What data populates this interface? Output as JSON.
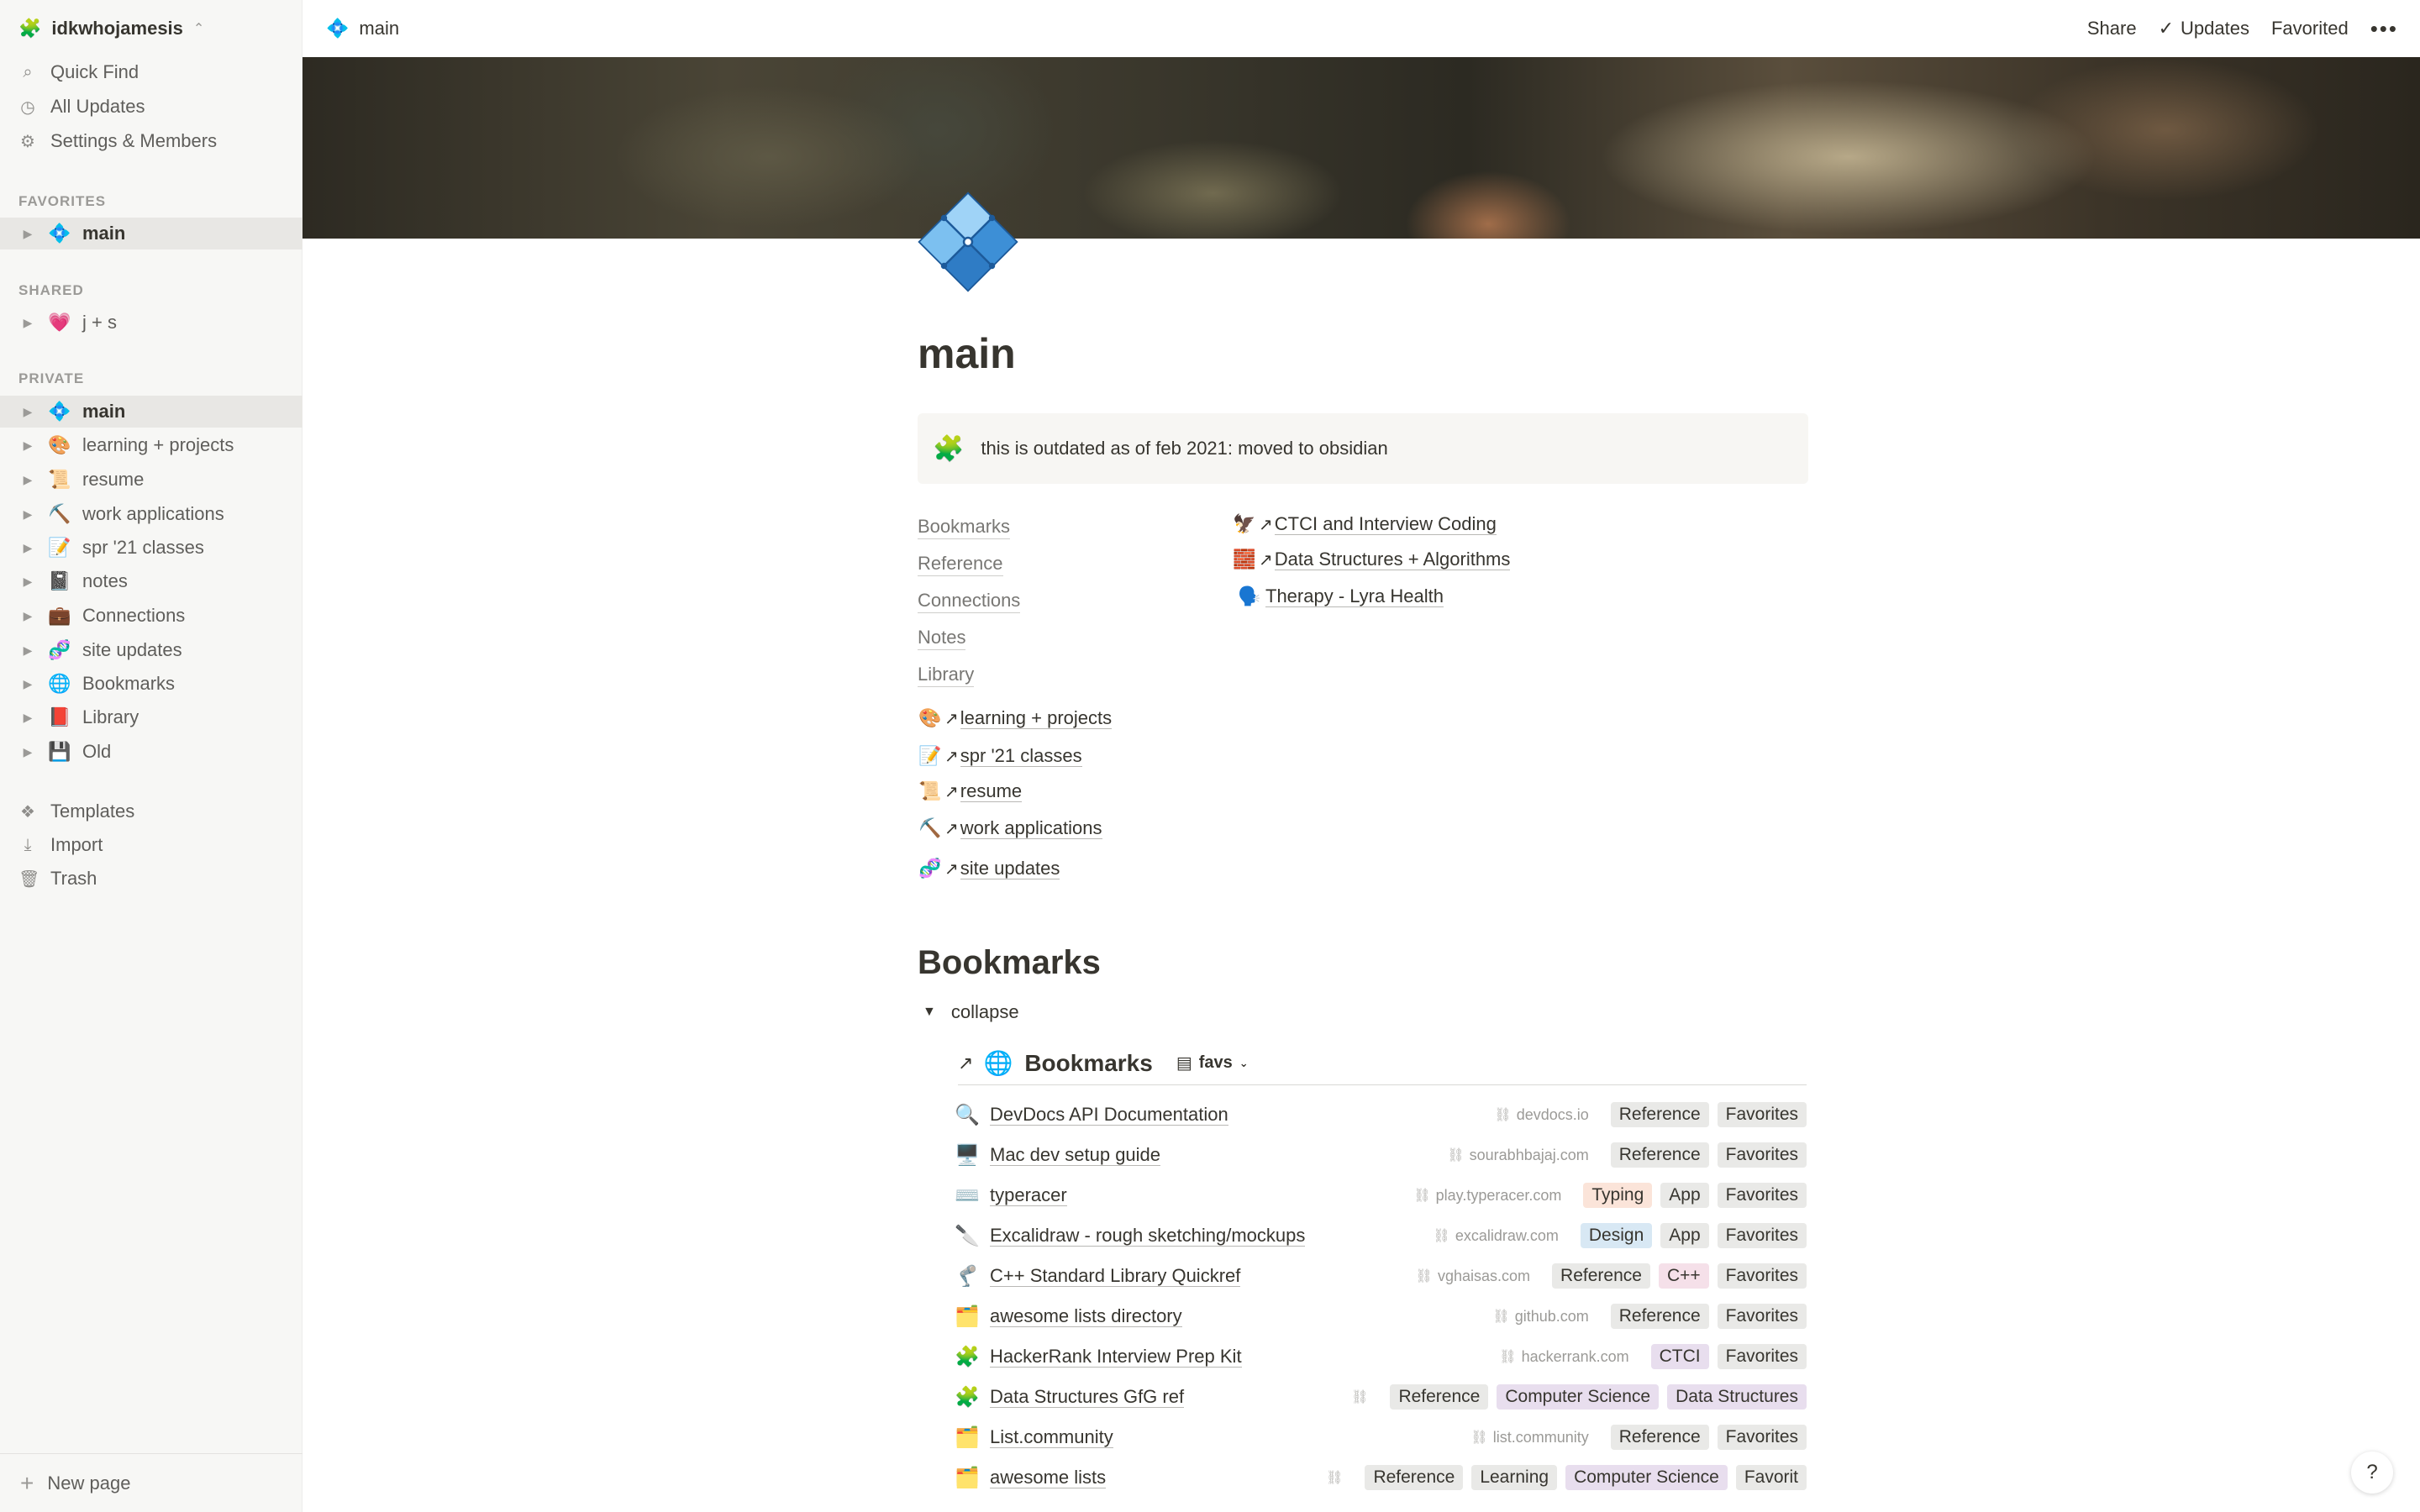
{
  "workspace": {
    "icon": "🧩",
    "name": "idkwhojamesis",
    "switch_icon": "⌃"
  },
  "sidebar": {
    "utilities": [
      {
        "icon": "⌕",
        "label": "Quick Find"
      },
      {
        "icon": "◷",
        "label": "All Updates"
      },
      {
        "icon": "⚙",
        "label": "Settings & Members"
      }
    ],
    "favorites_label": "FAVORITES",
    "favorites": [
      {
        "emoji": "💠",
        "label": "main"
      }
    ],
    "shared_label": "SHARED",
    "shared": [
      {
        "emoji": "💗",
        "label": "j + s"
      }
    ],
    "private_label": "PRIVATE",
    "private": [
      {
        "emoji": "💠",
        "label": "main"
      },
      {
        "emoji": "🎨",
        "label": "learning + projects"
      },
      {
        "emoji": "📜",
        "label": "resume"
      },
      {
        "emoji": "⛏️",
        "label": "work applications"
      },
      {
        "emoji": "📝",
        "label": "spr '21 classes"
      },
      {
        "emoji": "📓",
        "label": "notes"
      },
      {
        "emoji": "💼",
        "label": "Connections"
      },
      {
        "emoji": "🧬",
        "label": "site updates"
      },
      {
        "emoji": "🌐",
        "label": "Bookmarks"
      },
      {
        "emoji": "📕",
        "label": "Library"
      },
      {
        "emoji": "💾",
        "label": "Old"
      }
    ],
    "bottom": [
      {
        "icon": "❖",
        "label": "Templates"
      },
      {
        "icon": "⤓",
        "label": "Import"
      },
      {
        "icon": "🗑",
        "label": "Trash"
      }
    ],
    "new_page": "New page"
  },
  "topbar": {
    "page_icon": "💠",
    "page_name": "main",
    "share": "Share",
    "updates_check": "✓",
    "updates": "Updates",
    "favorited": "Favorited",
    "more": "•••"
  },
  "page": {
    "title": "main",
    "callout_icon": "🧩",
    "callout_text": "this is outdated as of feb 2021: moved to obsidian",
    "links_left": [
      "Bookmarks",
      "Reference",
      "Connections",
      "Notes",
      "Library"
    ],
    "mentions_right": [
      {
        "emoji": "🦅",
        "arrow": "↗",
        "text": "CTCI and Interview Coding"
      },
      {
        "emoji": "🧱",
        "arrow": "↗",
        "text": "Data Structures + Algorithms"
      },
      {
        "emoji": "🗣️",
        "arrow": "",
        "text": "Therapy - Lyra Health"
      }
    ],
    "mentions_left": [
      {
        "emoji": "🎨",
        "arrow": "↗",
        "text": "learning + projects"
      },
      {
        "emoji": "📝",
        "arrow": "↗",
        "text": "spr '21 classes"
      },
      {
        "emoji": "📜",
        "arrow": "↗",
        "text": "resume"
      },
      {
        "emoji": "⛏️",
        "arrow": "↗",
        "text": "work applications"
      },
      {
        "emoji": "🧬",
        "arrow": "↗",
        "text": "site updates"
      }
    ],
    "bookmarks_heading": "Bookmarks",
    "toggle_icon": "▼",
    "toggle_label": "collapse"
  },
  "database": {
    "arrow": "↗",
    "icon": "🌐",
    "title": "Bookmarks",
    "view_icon": "▤",
    "view": "favs",
    "view_chevron": "⌄",
    "link_icon": "⛓",
    "rows": [
      {
        "icon": "🔍",
        "title": "DevDocs API Documentation",
        "url": "devdocs.io",
        "tags": [
          [
            "Reference",
            "gray"
          ],
          [
            "Favorites",
            "gray"
          ]
        ]
      },
      {
        "icon": "🖥️",
        "title": "Mac dev setup guide",
        "url": "sourabhbajaj.com",
        "tags": [
          [
            "Reference",
            "gray"
          ],
          [
            "Favorites",
            "gray"
          ]
        ]
      },
      {
        "icon": "⌨️",
        "title": "typeracer",
        "url": "play.typeracer.com",
        "tags": [
          [
            "Typing",
            "orange"
          ],
          [
            "App",
            "gray"
          ],
          [
            "Favorites",
            "gray"
          ]
        ]
      },
      {
        "icon": "🔪",
        "title": "Excalidraw - rough sketching/mockups",
        "url": "excalidraw.com",
        "tags": [
          [
            "Design",
            "blue"
          ],
          [
            "App",
            "gray"
          ],
          [
            "Favorites",
            "gray"
          ]
        ]
      },
      {
        "icon": "🦿",
        "title": "C++ Standard Library Quickref",
        "url": "vghaisas.com",
        "tags": [
          [
            "Reference",
            "gray"
          ],
          [
            "C++",
            "pink"
          ],
          [
            "Favorites",
            "gray"
          ]
        ]
      },
      {
        "icon": "🗂️",
        "title": "awesome lists directory",
        "url": "github.com",
        "tags": [
          [
            "Reference",
            "gray"
          ],
          [
            "Favorites",
            "gray"
          ]
        ]
      },
      {
        "icon": "🧩",
        "title": "HackerRank Interview Prep Kit",
        "url": "hackerrank.com",
        "tags": [
          [
            "CTCI",
            "purple"
          ],
          [
            "Favorites",
            "gray"
          ]
        ]
      },
      {
        "icon": "🧩",
        "title": "Data Structures GfG ref",
        "url": "",
        "tags": [
          [
            "Reference",
            "gray"
          ],
          [
            "Computer Science",
            "purple"
          ],
          [
            "Data Structures",
            "purple"
          ]
        ]
      },
      {
        "icon": "🗂️",
        "title": "List.community",
        "url": "list.community",
        "tags": [
          [
            "Reference",
            "gray"
          ],
          [
            "Favorites",
            "gray"
          ]
        ]
      },
      {
        "icon": "🗂️",
        "title": "awesome lists",
        "url": "",
        "tags": [
          [
            "Reference",
            "gray"
          ],
          [
            "Learning",
            "gray"
          ],
          [
            "Computer Science",
            "purple"
          ],
          [
            "Favorit",
            "gray"
          ]
        ]
      }
    ]
  },
  "help": "?"
}
